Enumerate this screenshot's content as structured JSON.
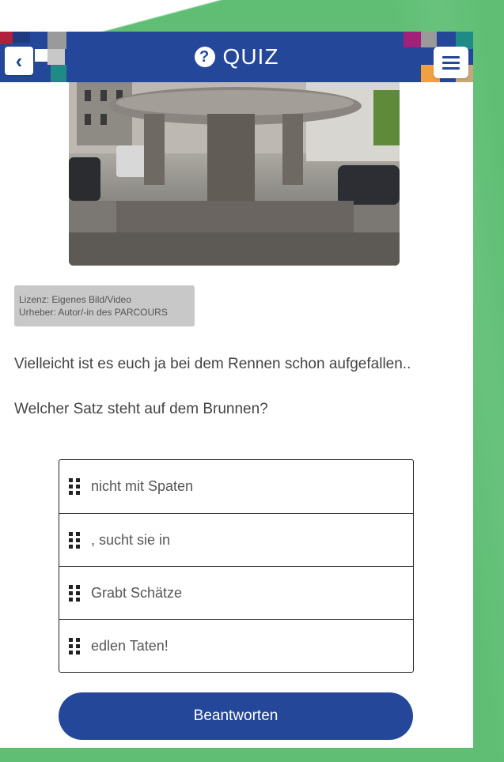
{
  "header": {
    "title": "QUIZ",
    "title_icon": "question-circle-icon",
    "back_icon": "chevron-left-icon",
    "menu_icon": "hamburger-menu-icon",
    "color": "#24479a"
  },
  "image": {
    "subject": "stone fountain on town square"
  },
  "license": {
    "line1": "Lizenz: Eigenes Bild/Video",
    "line2": "Urheber: Autor/-in des PARCOURS"
  },
  "content": {
    "intro": "Vielleicht ist es euch ja bei dem Rennen schon aufgefallen..",
    "question": "Welcher Satz steht auf dem Brunnen?"
  },
  "ordering_items": [
    {
      "label": "nicht mit Spaten"
    },
    {
      "label": ", sucht sie in"
    },
    {
      "label": "Grabt Schätze"
    },
    {
      "label": "edlen Taten!"
    }
  ],
  "actions": {
    "submit_label": "Beantworten"
  },
  "colors": {
    "background_green": "#5fbe73",
    "accent_blue": "#24479a"
  }
}
